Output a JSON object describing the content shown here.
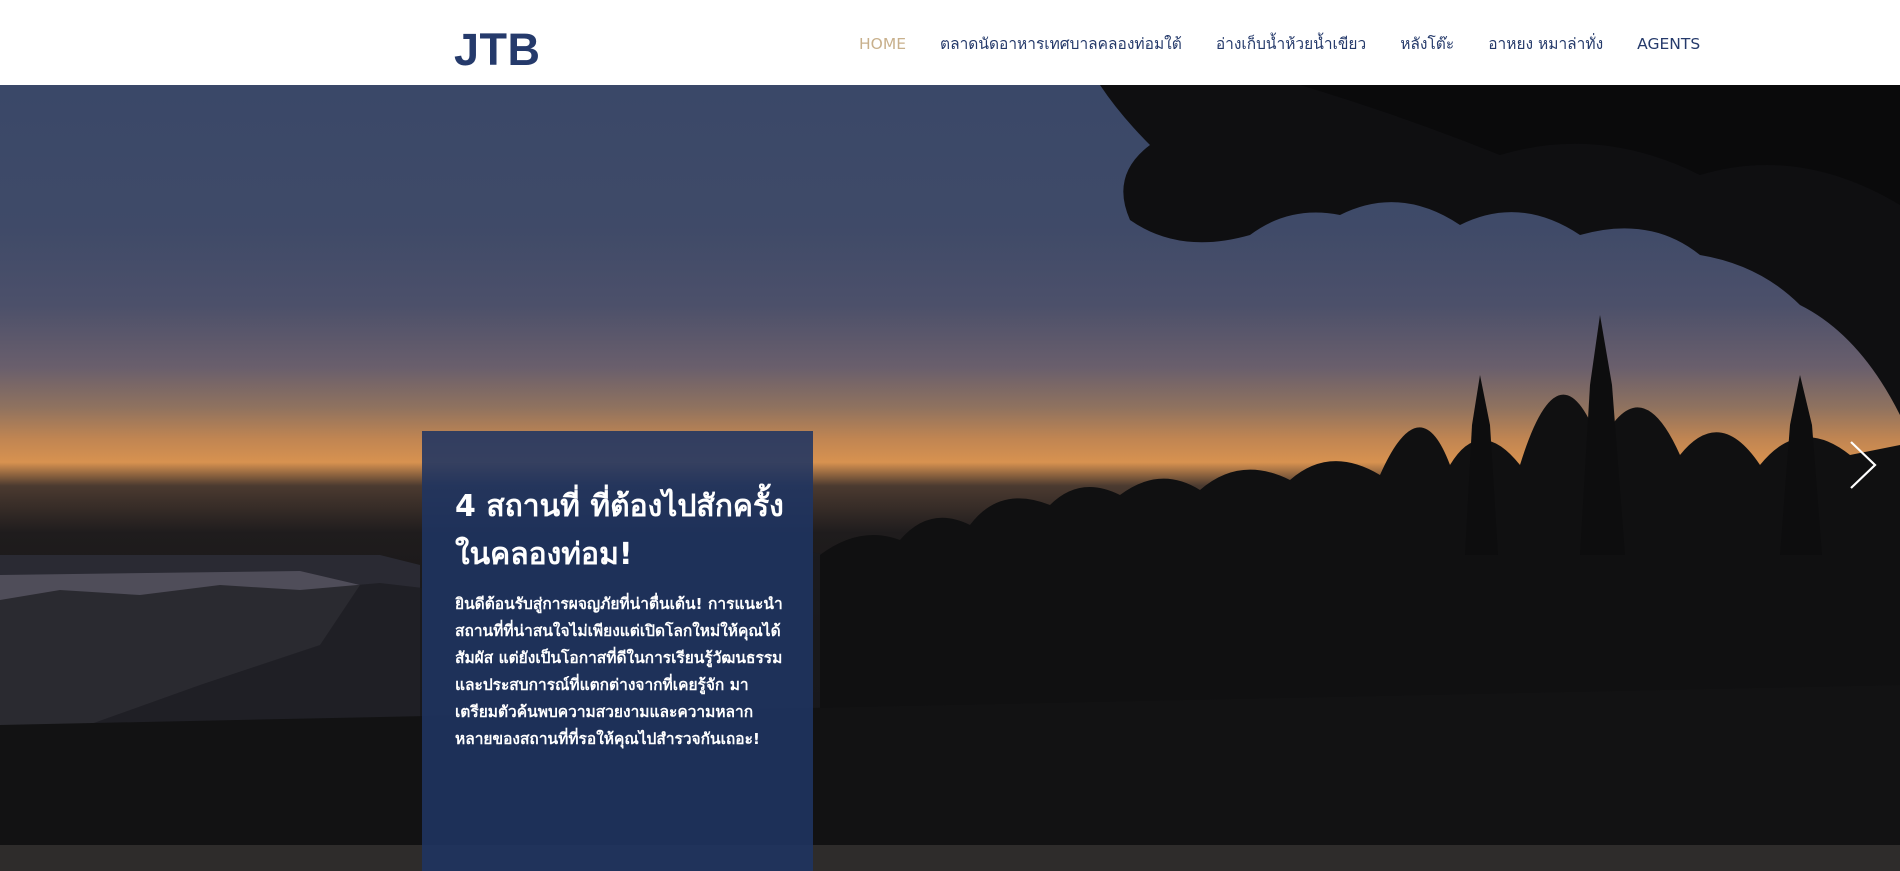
{
  "header": {
    "logo": "JTB",
    "nav": [
      {
        "label": "HOME",
        "active": true
      },
      {
        "label": "ตลาดนัดอาหารเทศบาลคลองท่อมใต้",
        "active": false
      },
      {
        "label": "อ่างเก็บน้ำห้วยน้ำเขียว",
        "active": false
      },
      {
        "label": "หลังโต๊ะ",
        "active": false
      },
      {
        "label": "อาหยง หมาล่าทั่ง",
        "active": false
      },
      {
        "label": "AGENTS",
        "active": false
      }
    ]
  },
  "hero": {
    "title": "4 สถานที่ ที่ต้องไปสักครั้งในคลองท่อม!",
    "body": "ยินดีต้อนรับสู่การผจญภัยที่น่าตื่นเต้น! การแนะนำสถานที่ที่น่าสนใจไม่เพียงแต่เปิดโลกใหม่ให้คุณได้สัมผัส แต่ยังเป็นโอกาสที่ดีในการเรียนรู้วัฒนธรรมและประสบการณ์ที่แตกต่างจากที่เคยรู้จัก มาเตรียมตัวค้นพบความสวยงามและความหลากหลายของสถานที่ที่รอให้คุณไปสำรวจกันเถอะ!",
    "next_icon": "chevron-right-icon"
  },
  "colors": {
    "brand": "#253a6b",
    "nav_active": "#c8b08c",
    "card_bg": "#1f3462"
  }
}
